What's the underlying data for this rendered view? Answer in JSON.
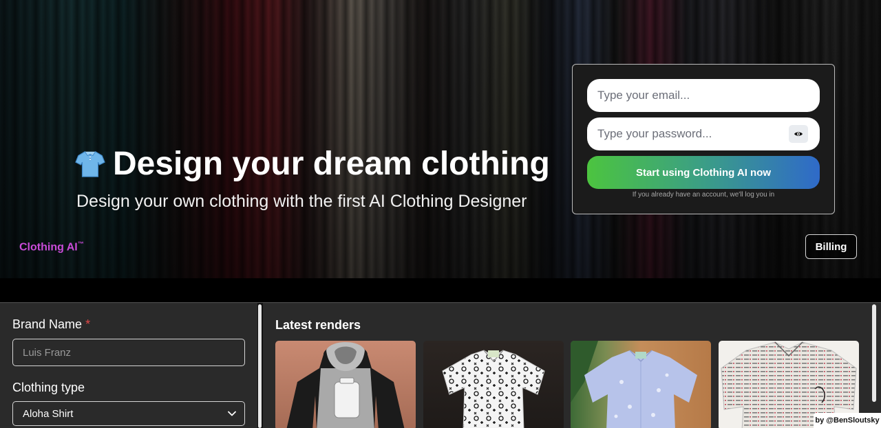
{
  "hero": {
    "headline": "Design your dream clothing",
    "subheadline": "Design your own clothing with the first AI Clothing Designer",
    "brand_name": "Clothing AI",
    "brand_mark": "™",
    "billing_label": "Billing"
  },
  "login": {
    "email_placeholder": "Type your email...",
    "password_placeholder": "Type your password...",
    "cta_label": "Start using Clothing AI now",
    "note": "If you already have an account, we'll log you in"
  },
  "form": {
    "brand_name_label": "Brand Name",
    "required_marker": "*",
    "brand_name_placeholder": "Luis Franz",
    "clothing_type_label": "Clothing type",
    "clothing_type_value": "Aloha Shirt"
  },
  "renders": {
    "title": "Latest renders",
    "items": [
      "hoodie-render",
      "aloha-shirt-monogram-render",
      "light-blue-shirt-render",
      "newsprint-shirt-render"
    ]
  },
  "credit": "by @BenSloutsky",
  "colors": {
    "brand_accent": "#c94bd8",
    "cta_gradient_start": "#4cc43f",
    "cta_gradient_end": "#2f6ac9",
    "required": "#e04848",
    "panel_bg": "#2a2a2a"
  }
}
